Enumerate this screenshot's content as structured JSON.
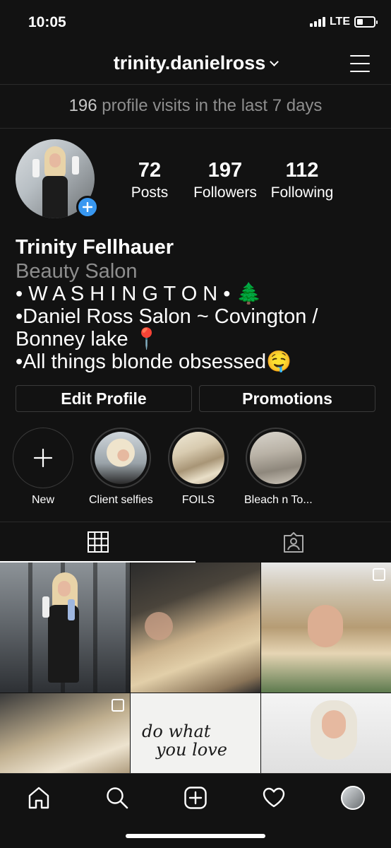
{
  "status": {
    "time": "10:05",
    "network": "LTE"
  },
  "header": {
    "username": "trinity.danielross"
  },
  "visits": {
    "count": "196",
    "text": " profile visits in the last 7 days"
  },
  "stats": {
    "posts": {
      "value": "72",
      "label": "Posts"
    },
    "followers": {
      "value": "197",
      "label": "Followers"
    },
    "following": {
      "value": "112",
      "label": "Following"
    }
  },
  "bio": {
    "name": "Trinity Fellhauer",
    "category": "Beauty Salon",
    "lines": [
      "• W A S H I N G T O N • 🌲",
      "•Daniel Ross Salon ~ Covington /",
      "Bonney lake 📍",
      "•All things blonde obsessed🤤"
    ]
  },
  "buttons": {
    "edit": "Edit Profile",
    "promotions": "Promotions"
  },
  "highlights": [
    {
      "label": "New"
    },
    {
      "label": "Client selfies"
    },
    {
      "label": "FOILS"
    },
    {
      "label": "Bleach n To..."
    }
  ],
  "posts_grid": {
    "text_post": [
      "do what",
      "you love"
    ]
  },
  "colors": {
    "accent": "#3897f0",
    "background": "#121212",
    "muted": "#8e8e8e"
  },
  "icons": {
    "tabs": [
      "grid-icon",
      "tagged-icon"
    ],
    "nav": [
      "home-icon",
      "search-icon",
      "add-post-icon",
      "heart-icon",
      "profile-avatar"
    ]
  }
}
